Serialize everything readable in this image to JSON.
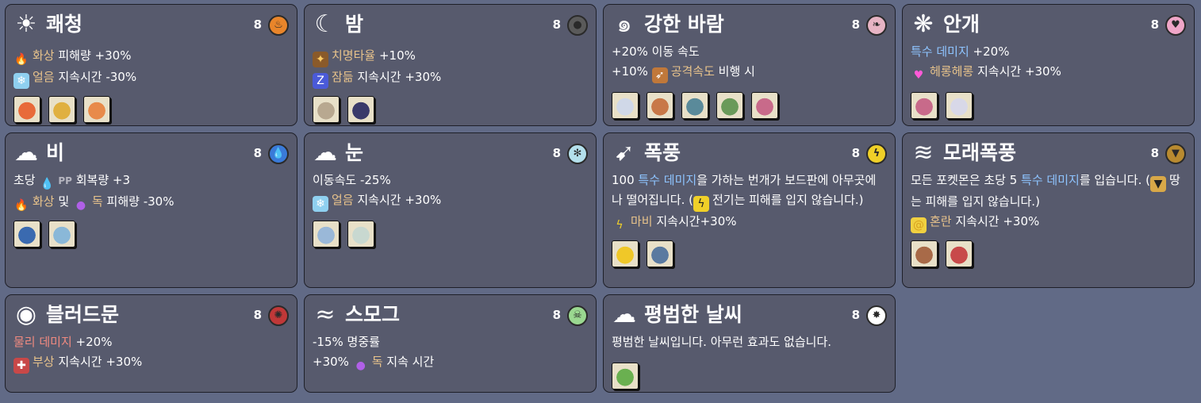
{
  "cards": [
    {
      "title": "쾌청",
      "count": "8",
      "icon": "sun-icon",
      "badge_icon": "fire-badge-icon",
      "badge_color": "#e9852a",
      "lines": [
        [
          {
            "icon": "fire-icon"
          },
          {
            "text": "화상",
            "c": "gold"
          },
          {
            "text": " 피해량 +30%"
          }
        ],
        [
          {
            "icon": "ice-icon"
          },
          {
            "text": "얼음",
            "c": "gold"
          },
          {
            "text": " 지속시간 -30%"
          }
        ]
      ],
      "pokemon": [
        {
          "color": "#e86a3a"
        },
        {
          "color": "#e0b040"
        },
        {
          "color": "#e88a4a"
        }
      ]
    },
    {
      "title": "밤",
      "count": "8",
      "icon": "moon-icon",
      "badge_icon": "dark-badge-icon",
      "badge_color": "#5a5a5a",
      "lines": [
        [
          {
            "icon": "critical-icon"
          },
          {
            "text": "치명타율",
            "c": "gold"
          },
          {
            "text": " +10%"
          }
        ],
        [
          {
            "icon": "sleep-icon"
          },
          {
            "text": "잠듦",
            "c": "gold"
          },
          {
            "text": " 지속시간 +30%"
          }
        ]
      ],
      "pokemon": [
        {
          "color": "#b8a890"
        },
        {
          "color": "#3a3a6a"
        }
      ]
    },
    {
      "title": "강한 바람",
      "count": "8",
      "icon": "wind-icon",
      "badge_icon": "flying-badge-icon",
      "badge_color": "#e7b4c4",
      "lines": [
        [
          {
            "text": "+20% 이동 속도"
          }
        ],
        [
          {
            "text": "+10% "
          },
          {
            "icon": "attack-speed-icon"
          },
          {
            "text": "공격속도",
            "c": "gold"
          },
          {
            "text": " 비행 시"
          }
        ]
      ],
      "pokemon": [
        {
          "color": "#d0d8e8"
        },
        {
          "color": "#c87848"
        },
        {
          "color": "#5a8a9a"
        },
        {
          "color": "#6a9a5a"
        },
        {
          "color": "#c86a8a"
        }
      ]
    },
    {
      "title": "안개",
      "count": "8",
      "icon": "fog-icon",
      "badge_icon": "fairy-badge-icon",
      "badge_color": "#f0a6c8",
      "lines": [
        [
          {
            "text": "특수 데미지",
            "c": "blue"
          },
          {
            "text": " +20%"
          }
        ],
        [
          {
            "icon": "heart-icon"
          },
          {
            "text": "헤롱헤롱",
            "c": "gold"
          },
          {
            "text": " 지속시간 +30%"
          }
        ]
      ],
      "pokemon": [
        {
          "color": "#c86a8a"
        },
        {
          "color": "#d8d8e8"
        }
      ]
    },
    {
      "title": "비",
      "count": "8",
      "icon": "rain-cloud-icon",
      "badge_icon": "water-badge-icon",
      "badge_color": "#3a7ad8",
      "lines": [
        [
          {
            "text": "초당 "
          },
          {
            "icon": "water-drop-icon"
          },
          {
            "text": "PP",
            "c": "grey"
          },
          {
            "text": " 회복량 +3"
          }
        ],
        [
          {
            "icon": "fire-icon"
          },
          {
            "text": "화상",
            "c": "gold"
          },
          {
            "text": " 및 "
          },
          {
            "icon": "poison-icon"
          },
          {
            "text": "독",
            "c": "gold"
          },
          {
            "text": " 피해량 -30%"
          }
        ]
      ],
      "pokemon": [
        {
          "color": "#3a6ab0"
        },
        {
          "color": "#8ab8d8"
        }
      ]
    },
    {
      "title": "눈",
      "count": "8",
      "icon": "snow-cloud-icon",
      "badge_icon": "ice-badge-icon",
      "badge_color": "#b4e0ec",
      "lines": [
        [
          {
            "text": "이동속도 -25%"
          }
        ],
        [
          {
            "icon": "ice-icon"
          },
          {
            "text": "얼음",
            "c": "gold"
          },
          {
            "text": " 지속시간 +30%"
          }
        ]
      ],
      "pokemon": [
        {
          "color": "#9ab8d8"
        },
        {
          "color": "#c8d8d0"
        }
      ]
    },
    {
      "title": "폭풍",
      "count": "8",
      "icon": "storm-icon",
      "badge_icon": "electric-badge-icon",
      "badge_color": "#f0d028",
      "lines": [
        [
          {
            "text": "100 "
          },
          {
            "text": "특수 데미지",
            "c": "blue"
          },
          {
            "text": "을 가하는 번개가 보드판에 아무곳에나 떨어집니다. ("
          },
          {
            "icon": "electric-icon"
          },
          {
            "text": "전기는 피해를 입지 않습니다.)"
          }
        ],
        [
          {
            "icon": "paralysis-icon"
          },
          {
            "text": "마비",
            "c": "gold"
          },
          {
            "text": " 지속시간+30%"
          }
        ]
      ],
      "pokemon": [
        {
          "color": "#f0c828"
        },
        {
          "color": "#5a7aa0"
        }
      ]
    },
    {
      "title": "모래폭풍",
      "count": "8",
      "icon": "tornado-icon",
      "badge_icon": "ground-badge-icon",
      "badge_color": "#b88a30",
      "lines": [
        [
          {
            "text": "모든 포켓몬은 초당 5 "
          },
          {
            "text": "특수 데미지",
            "c": "blue"
          },
          {
            "text": "를 입습니다. ("
          },
          {
            "icon": "ground-icon"
          },
          {
            "text": "땅는 피해를 입지 않습니다.)"
          }
        ],
        [
          {
            "icon": "confusion-icon"
          },
          {
            "text": "혼란",
            "c": "gold"
          },
          {
            "text": " 지속시간 +30%"
          }
        ]
      ],
      "pokemon": [
        {
          "color": "#a86a48"
        },
        {
          "color": "#c84a4a"
        }
      ]
    },
    {
      "title": "블러드문",
      "count": "8",
      "icon": "bloodmoon-icon",
      "badge_icon": "monster-badge-icon",
      "badge_color": "#c03838",
      "lines": [
        [
          {
            "text": "물리 데미지",
            "c": "red"
          },
          {
            "text": " +20%"
          }
        ],
        [
          {
            "icon": "wound-icon"
          },
          {
            "text": "부상",
            "c": "gold"
          },
          {
            "text": " 지속시간 +30%"
          }
        ]
      ],
      "pokemon": []
    },
    {
      "title": "스모그",
      "count": "8",
      "icon": "smog-icon",
      "badge_icon": "poison-badge-icon",
      "badge_color": "#9ad890",
      "lines": [
        [
          {
            "text": "-15% 명중률"
          }
        ],
        [
          {
            "text": "+30% "
          },
          {
            "icon": "poison-icon"
          },
          {
            "text": "독",
            "c": "gold"
          },
          {
            "text": " 지속 시간"
          }
        ]
      ],
      "pokemon": []
    },
    {
      "title": "평범한 날씨",
      "count": "8",
      "icon": "cloud-icon",
      "badge_icon": "normal-badge-icon",
      "badge_color": "#ffffff",
      "lines": [
        [
          {
            "text": "평범한 날씨입니다. 아무런 효과도 없습니다."
          }
        ]
      ],
      "pokemon": [
        {
          "color": "#6ab050"
        }
      ]
    }
  ]
}
